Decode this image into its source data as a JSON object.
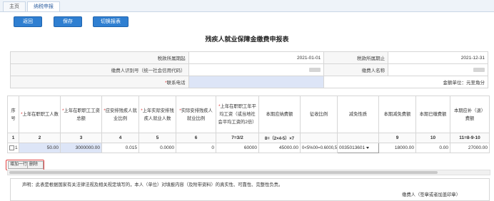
{
  "tabs": [
    {
      "label": "主页"
    },
    {
      "label": "纳税申报"
    }
  ],
  "toolbar": {
    "back": "返回",
    "save": "保存",
    "switch": "切换报表"
  },
  "title": "残疾人就业保障金缴费申报表",
  "info": {
    "period_start_label": "税款所属期起",
    "period_start": "2021-01-01",
    "period_end_label": "税款所属期止",
    "period_end": "2021-12-31",
    "payer_id_label": "缴费人识别号（统一社会信用代码）",
    "payer_name_label": "缴费人名称",
    "phone_label": "联系电话",
    "amount_unit": "金额单位：元至角分"
  },
  "columns": [
    "序号",
    "上年在职职工人数",
    "上年在职职工工资总额",
    "应安排残疾人就业比例",
    "上年实际安排残疾人就业人数",
    "实际安排残疾人就业比例",
    "上年在职职工年平均工资（或当地社会平均工资的2倍）",
    "本期应纳费额",
    "征收比例",
    "减免性质",
    "本期减免费额",
    "本期已缴费额",
    "本期应补（退）费额"
  ],
  "column_numbers": [
    "1",
    "2",
    "3",
    "4",
    "5",
    "6",
    "7=3/2",
    "8=（2×4-5）×7",
    "",
    "",
    "9",
    "10",
    "11=8-9-10"
  ],
  "rows": [
    {
      "seq": "1",
      "employees": "50.00",
      "total_wages": "3000000.00",
      "required_ratio": "0.015",
      "actual_employed": "0.0000",
      "actual_ratio": "0",
      "avg_wage": "60000",
      "payable": "45000.00",
      "collect_ratio": "0<5%00=0.6000,5",
      "relief_code": "0035013601",
      "relief_amount": "18000.00",
      "paid": "0.00",
      "due": "27000.00"
    }
  ],
  "row_actions": {
    "add": "增加一行",
    "delete": "删除"
  },
  "declaration": {
    "text": "声明：此表是根据国家有关法律法规及相关规定填写的，本人（单位）对填报内容（及附带资料）的真实性、可靠性、完整性负责。",
    "sign": "缴费人（签章或者加盖印章）"
  }
}
